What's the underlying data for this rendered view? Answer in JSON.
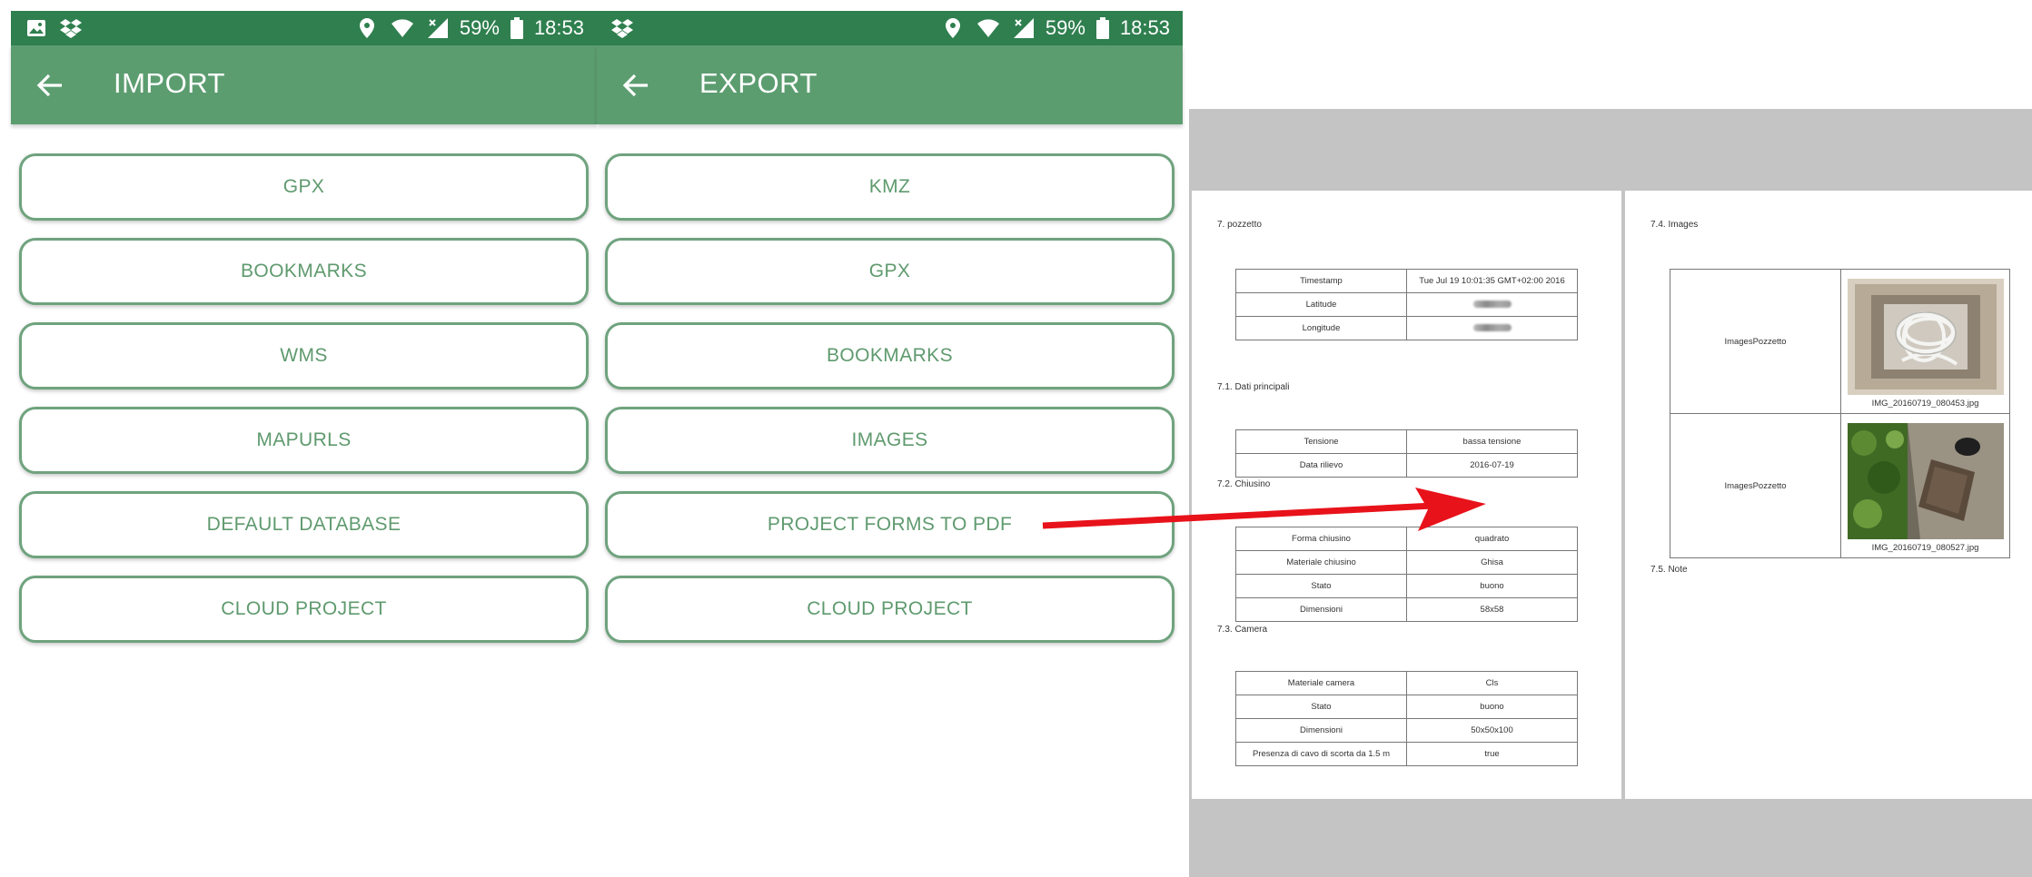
{
  "status_bar": {
    "battery_percent": "59%",
    "time": "18:53",
    "icons": [
      "image-icon",
      "dropbox-icon",
      "location-icon",
      "wifi-icon",
      "signal-icon",
      "battery-icon"
    ]
  },
  "import_screen": {
    "title": "IMPORT",
    "buttons": [
      "GPX",
      "BOOKMARKS",
      "WMS",
      "MAPURLS",
      "DEFAULT DATABASE",
      "CLOUD PROJECT"
    ]
  },
  "export_screen": {
    "title": "EXPORT",
    "buttons": [
      "KMZ",
      "GPX",
      "BOOKMARKS",
      "IMAGES",
      "PROJECT FORMS TO PDF",
      "CLOUD PROJECT"
    ]
  },
  "colors": {
    "status_bar": "#2f7f4f",
    "app_bar": "#5c9d70",
    "button_border": "#6fa37e",
    "button_text": "#5f9a6e",
    "arrow": "#e8121a"
  },
  "pdf": {
    "left_page": {
      "heading": "7. pozzetto",
      "main_table": [
        [
          "Timestamp",
          "Tue Jul 19 10:01:35 GMT+02:00 2016"
        ],
        [
          "Latitude",
          ""
        ],
        [
          "Longitude",
          ""
        ]
      ],
      "section_1": {
        "title": "7.1. Dati principali",
        "rows": [
          [
            "Tensione",
            "bassa tensione"
          ],
          [
            "Data rilievo",
            "2016-07-19"
          ]
        ]
      },
      "section_2": {
        "title": "7.2. Chiusino",
        "rows": [
          [
            "Forma chiusino",
            "quadrato"
          ],
          [
            "Materiale chiusino",
            "Ghisa"
          ],
          [
            "Stato",
            "buono"
          ],
          [
            "Dimensioni",
            "58x58"
          ]
        ]
      },
      "section_3": {
        "title": "7.3. Camera",
        "rows": [
          [
            "Materiale camera",
            "Cls"
          ],
          [
            "Stato",
            "buono"
          ],
          [
            "Dimensioni",
            "50x50x100"
          ],
          [
            "Presenza di cavo di scorta da 1.5 m",
            "true"
          ]
        ]
      }
    },
    "right_page": {
      "images_title": "7.4. Images",
      "images": [
        {
          "label": "ImagesPozzetto",
          "caption": "IMG_20160719_080453.jpg"
        },
        {
          "label": "ImagesPozzetto",
          "caption": "IMG_20160719_080527.jpg"
        }
      ],
      "notes_title": "7.5. Note"
    }
  }
}
